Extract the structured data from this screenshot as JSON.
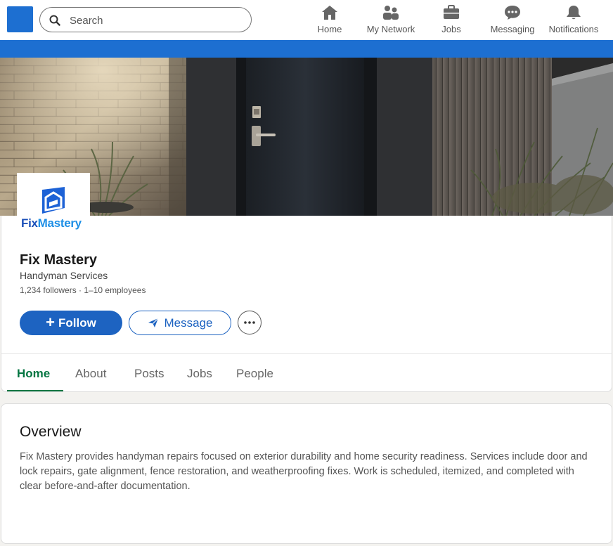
{
  "search": {
    "placeholder": "Search"
  },
  "nav": {
    "items": [
      {
        "label": "Home",
        "icon": "home-icon"
      },
      {
        "label": "My Network",
        "icon": "network-icon"
      },
      {
        "label": "Jobs",
        "icon": "briefcase-icon"
      },
      {
        "label": "Messaging",
        "icon": "messaging-icon"
      },
      {
        "label": "Notifications",
        "icon": "bell-icon"
      }
    ]
  },
  "brand_color": "#1d6fd1",
  "company": {
    "logo": {
      "part1": "Fix",
      "part2": "Mastery"
    },
    "name": "Fix Mastery",
    "industry": "Handyman Services",
    "meta": "1,234 followers · 1–10 employees"
  },
  "actions": {
    "follow_label": "Follow",
    "message_label": "Message"
  },
  "tabs": [
    {
      "label": "Home",
      "active": true
    },
    {
      "label": "About",
      "active": false
    },
    {
      "label": "Posts",
      "active": false
    },
    {
      "label": "Jobs",
      "active": false
    },
    {
      "label": "People",
      "active": false
    }
  ],
  "overview": {
    "title": "Overview",
    "body": "Fix Mastery provides handyman repairs focused on exterior durability and home security readiness. Services include door and lock repairs, gate alignment, fence restoration, and weatherproofing fixes. Work is scheduled, itemized, and completed with clear before-and-after documentation."
  }
}
